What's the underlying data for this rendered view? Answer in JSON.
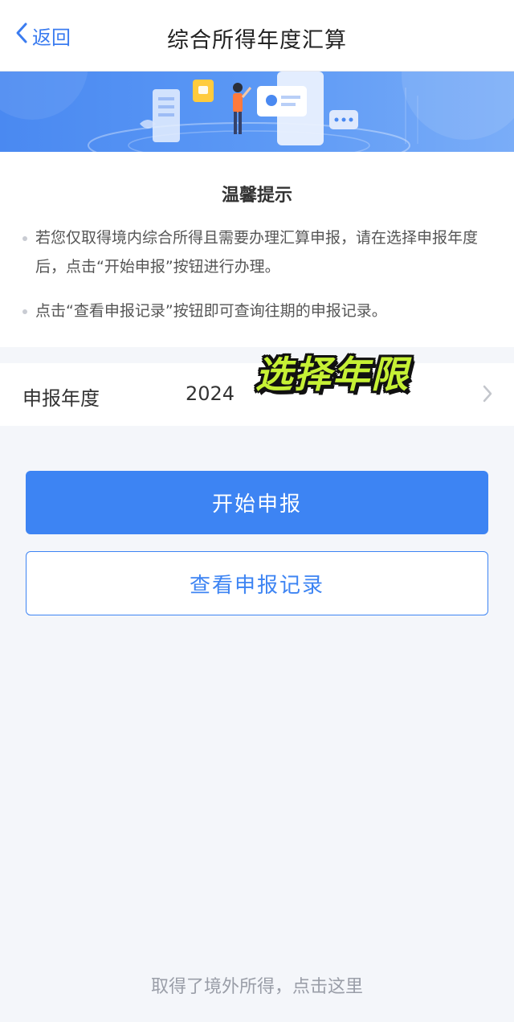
{
  "navbar": {
    "back_label": "返回",
    "title": "综合所得年度汇算"
  },
  "tips": {
    "title": "温馨提示",
    "items": [
      "若您仅取得境内综合所得且需要办理汇算申报，请在选择申报年度后，点击“开始申报”按钮进行办理。",
      "点击“查看申报记录”按钮即可查询往期的申报记录。"
    ]
  },
  "year_selector": {
    "label": "申报年度",
    "value": "2024"
  },
  "overlay_caption": "选择年限",
  "buttons": {
    "start": "开始申报",
    "records": "查看申报记录"
  },
  "footer": {
    "link": "取得了境外所得，点击这里"
  },
  "colors": {
    "accent": "#3d84f3",
    "banner_start": "#4f8ef2",
    "banner_end": "#6ea4f7",
    "caption": "#c6f135"
  },
  "icons": {
    "back": "chevron-left-icon",
    "row": "chevron-right-icon"
  }
}
